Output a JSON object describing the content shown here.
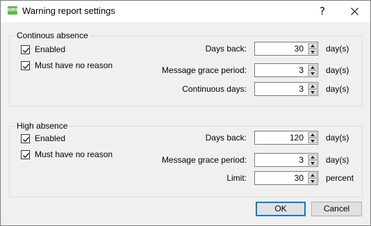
{
  "window": {
    "title": "Warning report settings",
    "app_icon_text": "GMS",
    "help_symbol": "?",
    "close_icon": "close-icon"
  },
  "continuous_absence": {
    "group_title": "Continous absence",
    "enabled": {
      "label": "Enabled",
      "checked": true
    },
    "must_have_no_reason": {
      "label": "Must have no reason",
      "checked": true
    },
    "days_back": {
      "label": "Days back:",
      "value": "30",
      "unit": "day(s)"
    },
    "message_grace_period": {
      "label": "Message grace period:",
      "value": "3",
      "unit": "day(s)"
    },
    "continuous_days": {
      "label": "Continuous days:",
      "value": "3",
      "unit": "day(s)"
    }
  },
  "high_absence": {
    "group_title": "High absence",
    "enabled": {
      "label": "Enabled",
      "checked": true
    },
    "must_have_no_reason": {
      "label": "Must have no reason",
      "checked": true
    },
    "days_back": {
      "label": "Days back:",
      "value": "120",
      "unit": "day(s)"
    },
    "message_grace_period": {
      "label": "Message grace period:",
      "value": "3",
      "unit": "day(s)"
    },
    "limit": {
      "label": "Limit:",
      "value": "30",
      "unit": "percent"
    }
  },
  "buttons": {
    "ok": "OK",
    "cancel": "Cancel"
  },
  "colors": {
    "dialog_background": "#f0f0f0",
    "titlebar_background": "#ffffff",
    "app_icon": "#5fb84a",
    "default_button_border": "#0078d7"
  }
}
